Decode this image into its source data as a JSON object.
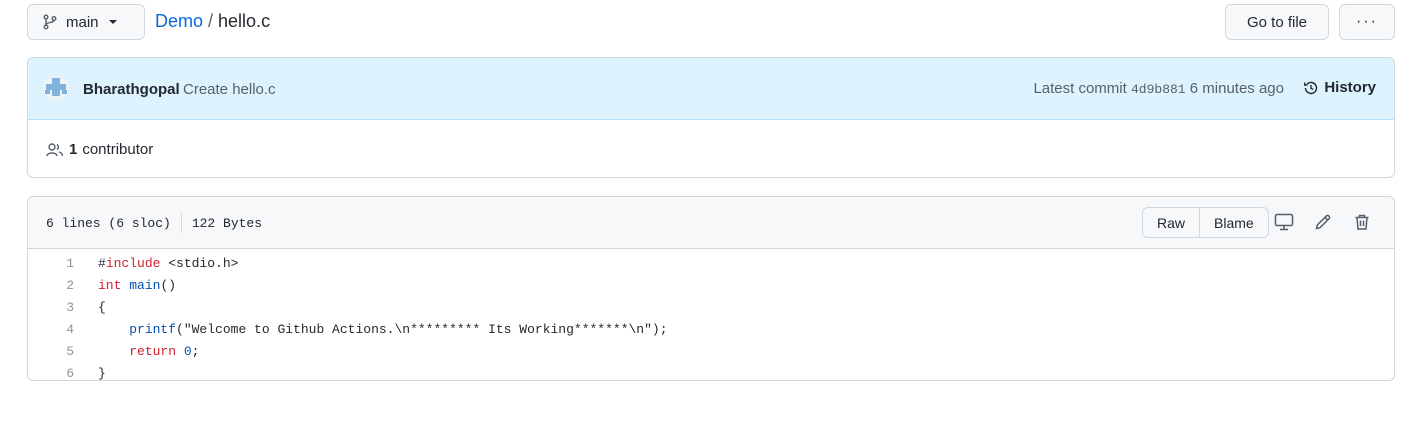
{
  "header": {
    "branch": "main",
    "repo": "Demo",
    "separator": "/",
    "filename": "hello.c",
    "go_to_file_label": "Go to file",
    "more_label": "···"
  },
  "commit": {
    "author": "Bharathgopal",
    "message": "Create hello.c",
    "latest_prefix": "Latest commit",
    "sha": "4d9b881",
    "time": "6 minutes ago",
    "history_label": "History"
  },
  "contributors": {
    "count": "1",
    "label": "contributor"
  },
  "file": {
    "lines_info": "6 lines (6 sloc)",
    "size": "122 Bytes",
    "raw_label": "Raw",
    "blame_label": "Blame"
  },
  "code": {
    "line_numbers": [
      "1",
      "2",
      "3",
      "4",
      "5",
      "6"
    ],
    "lines": [
      [
        {
          "t": "#"
        },
        {
          "t": "include",
          "c": "k"
        },
        {
          "t": " <stdio.h>"
        }
      ],
      [
        {
          "t": "int",
          "c": "k"
        },
        {
          "t": " "
        },
        {
          "t": "main",
          "c": "f"
        },
        {
          "t": "()"
        }
      ],
      [
        {
          "t": "{"
        }
      ],
      [
        {
          "t": "    "
        },
        {
          "t": "printf",
          "c": "f"
        },
        {
          "t": "(\"Welcome to Github Actions.\\n********* Its Working*******\\n\");"
        }
      ],
      [
        {
          "t": "    "
        },
        {
          "t": "return",
          "c": "k"
        },
        {
          "t": " "
        },
        {
          "t": "0",
          "c": "n"
        },
        {
          "t": ";"
        }
      ],
      [
        {
          "t": "}"
        }
      ]
    ]
  },
  "colors": {
    "link": "#0969da",
    "commit_bg": "#ddf4ff",
    "keyword": "#cf222e",
    "function": "#0550ae"
  },
  "icons": [
    "git-branch-icon",
    "caret-down-icon",
    "avatar",
    "history-icon",
    "people-icon",
    "desktop-icon",
    "pencil-icon",
    "trash-icon"
  ]
}
